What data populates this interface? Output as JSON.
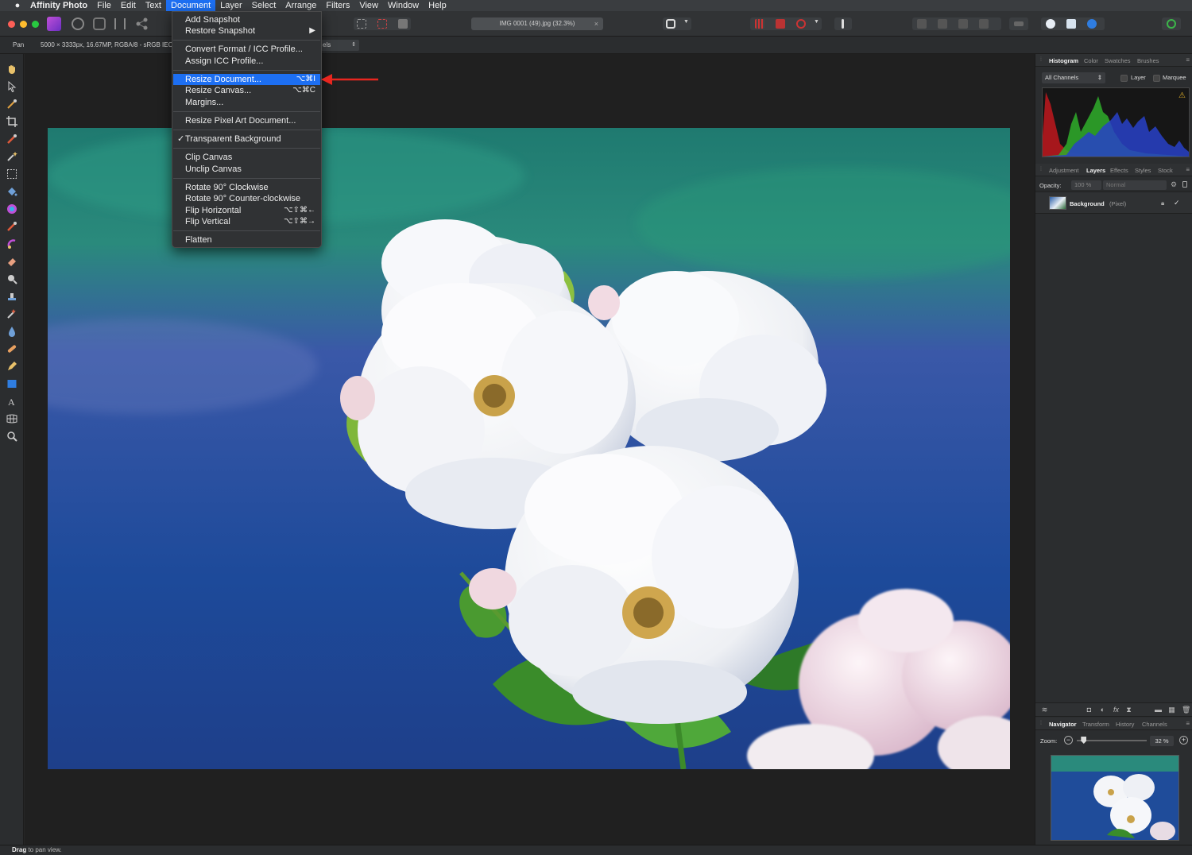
{
  "menubar": {
    "apple": "",
    "app": "Affinity Photo",
    "items": [
      "File",
      "Edit",
      "Text",
      "Document",
      "Layer",
      "Select",
      "Arrange",
      "Filters",
      "View",
      "Window",
      "Help"
    ],
    "active": "Document"
  },
  "toolbar": {
    "document_tab": "IMG 0001 (49).jpg (32.3%)",
    "close_glyph": "×"
  },
  "context_toolbar": {
    "tool_name": "Pan",
    "doc_info": "5000 × 3333px, 16.67MP, RGBA/8 - sRGB IEC",
    "units_suffix": "els"
  },
  "document_menu": {
    "items": [
      {
        "label": "Add Snapshot",
        "shortcut": ""
      },
      {
        "label": "Restore Snapshot",
        "shortcut": "▶"
      },
      {
        "label": "Convert Format / ICC Profile...",
        "shortcut": ""
      },
      {
        "label": "Assign ICC Profile...",
        "shortcut": ""
      },
      {
        "label": "Resize Document...",
        "shortcut": "⌥⌘I",
        "highlighted": true
      },
      {
        "label": "Resize Canvas...",
        "shortcut": "⌥⌘C"
      },
      {
        "label": "Margins...",
        "shortcut": ""
      },
      {
        "label": "Resize Pixel Art Document...",
        "shortcut": ""
      },
      {
        "label": "Transparent Background",
        "shortcut": "",
        "checked": true
      },
      {
        "label": "Clip Canvas",
        "shortcut": ""
      },
      {
        "label": "Unclip Canvas",
        "shortcut": ""
      },
      {
        "label": "Rotate 90° Clockwise",
        "shortcut": ""
      },
      {
        "label": "Rotate 90° Counter-clockwise",
        "shortcut": ""
      },
      {
        "label": "Flip Horizontal",
        "shortcut": "⌥⇧⌘←"
      },
      {
        "label": "Flip Vertical",
        "shortcut": "⌥⇧⌘→"
      },
      {
        "label": "Flatten",
        "shortcut": ""
      }
    ],
    "checkmark": "✓"
  },
  "histogram_panel": {
    "tabs": [
      "Histogram",
      "Color",
      "Swatches",
      "Brushes"
    ],
    "active_tab": "Histogram",
    "channel_select": "All Channels",
    "layer_label": "Layer",
    "marquee_label": "Marquee",
    "warning_glyph": "⚠"
  },
  "layers_panel": {
    "tabs": [
      "Adjustment",
      "Layers",
      "Effects",
      "Styles",
      "Stock"
    ],
    "active_tab": "Layers",
    "opacity_label": "Opacity:",
    "opacity_value": "100 %",
    "blend_mode": "Normal",
    "layer": {
      "name": "Background",
      "kind": "(Pixel)",
      "visible_glyph": "✓"
    }
  },
  "navigator_panel": {
    "tabs": [
      "Navigator",
      "Transform",
      "History",
      "Channels"
    ],
    "active_tab": "Navigator",
    "zoom_label": "Zoom:",
    "zoom_value": "32 %",
    "zoom_fraction": 0.1
  },
  "status": {
    "bold": "Drag",
    "rest": " to pan view."
  },
  "colors": {
    "menu_highlight": "#1d6ff2",
    "annotation_arrow": "#e8261f",
    "panel_bg": "#2b2d2f"
  }
}
